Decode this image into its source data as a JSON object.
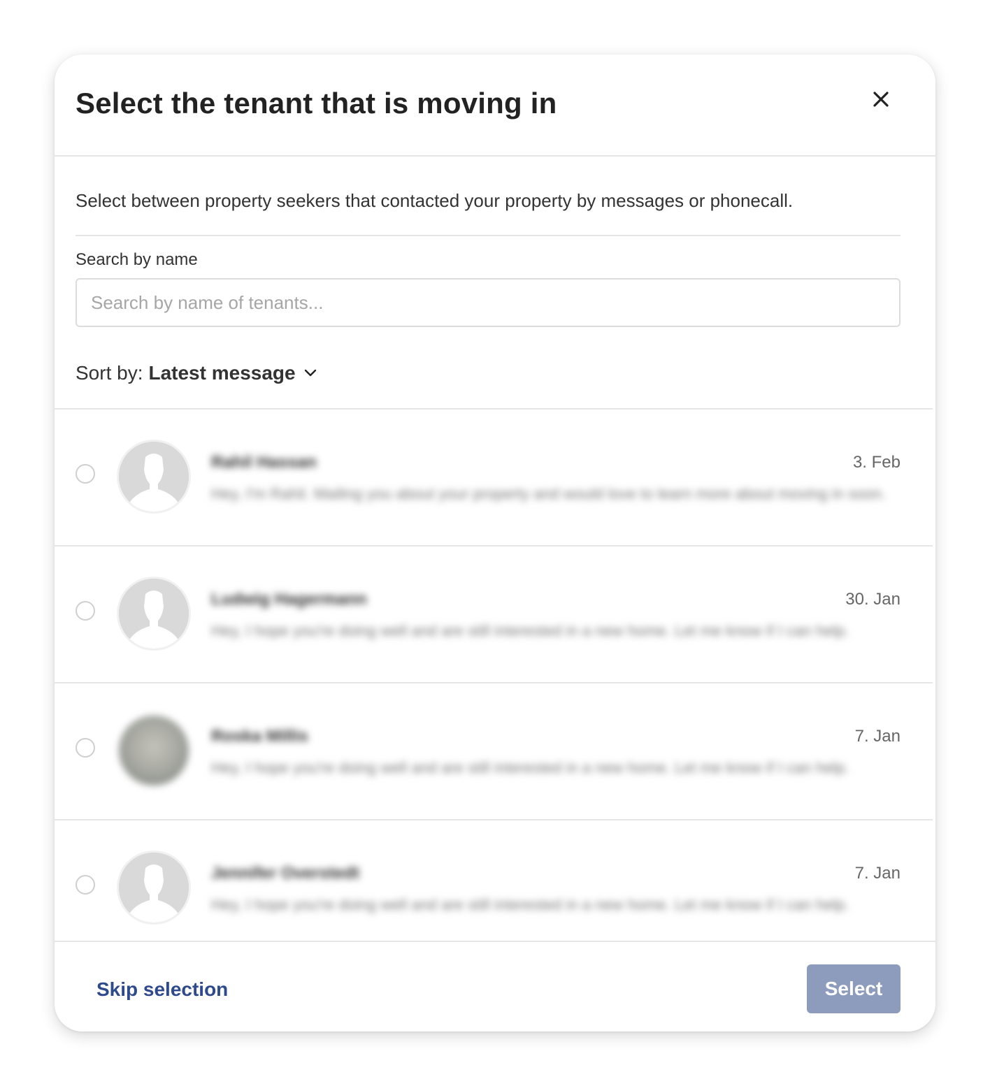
{
  "modal": {
    "title": "Select the tenant that is moving in",
    "close_icon": "close-icon",
    "intro": "Select between property seekers that contacted your property by messages or phonecall.",
    "search": {
      "label": "Search by name",
      "placeholder": "Search by name of tenants...",
      "value": ""
    },
    "sort": {
      "label": "Sort by:",
      "value": "Latest message",
      "icon": "chevron-down-icon"
    },
    "tenants": [
      {
        "name": "Rahil Hassan",
        "preview": "Hey, I'm Rahil. Mailing you about your property and would love to learn more about moving in soon.",
        "date": "3. Feb",
        "avatar": "default-avatar-icon"
      },
      {
        "name": "Ludwig Hagermann",
        "preview": "Hey, I hope you're doing well and are still interested in a new home. Let me know if I can help.",
        "date": "30. Jan",
        "avatar": "default-avatar-icon"
      },
      {
        "name": "Roska Millis",
        "preview": "Hey, I hope you're doing well and are still interested in a new home. Let me know if I can help.",
        "date": "7. Jan",
        "avatar": "photo-avatar"
      },
      {
        "name": "Jennifer Overstedt",
        "preview": "Hey, I hope you're doing well and are still interested in a new home. Let me know if I can help.",
        "date": "7. Jan",
        "avatar": "default-avatar-icon"
      }
    ],
    "footer": {
      "skip_label": "Skip selection",
      "select_label": "Select"
    },
    "colors": {
      "link": "#2e4a8c",
      "button_disabled": "#8d9cbd",
      "divider": "#e6e6e6"
    }
  }
}
